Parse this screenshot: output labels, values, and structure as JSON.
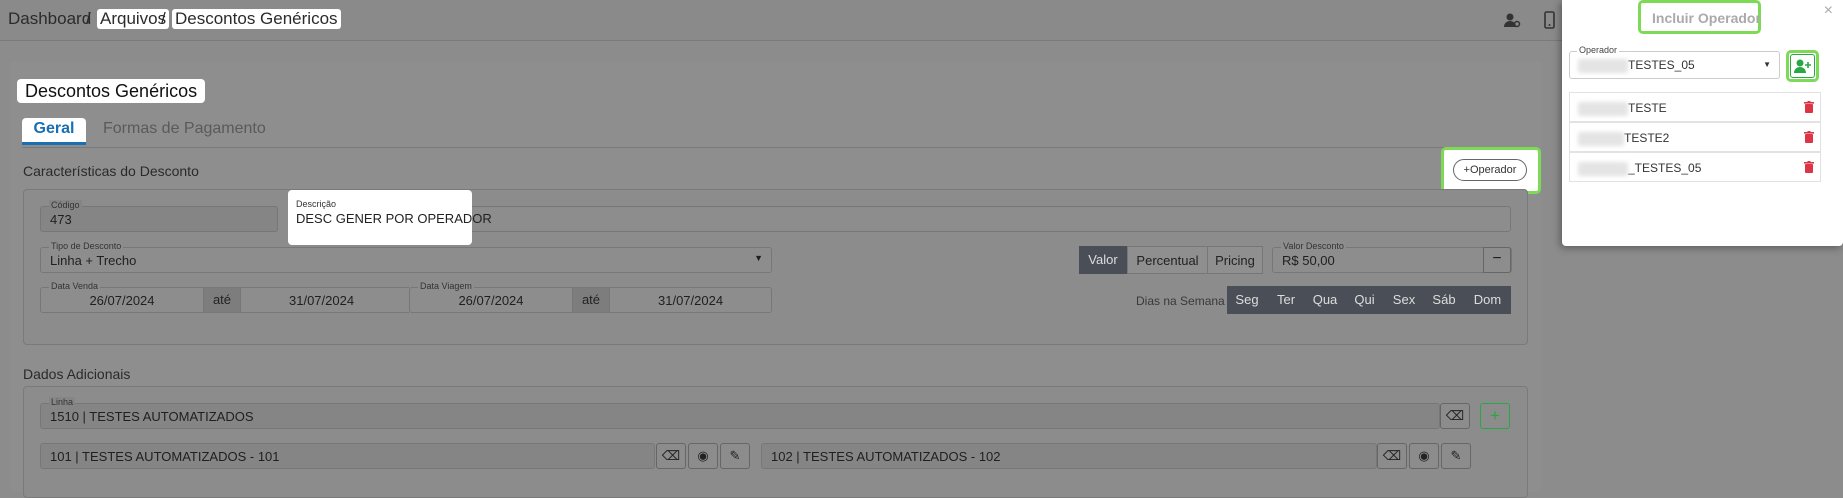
{
  "breadcrumb": {
    "dashboard": "Dashboard",
    "sep1": "/",
    "arquivos": "Arquivos",
    "sep2": "/",
    "current": "Descontos Genéricos"
  },
  "page_title": "Descontos Genéricos",
  "tabs": {
    "geral": "Geral",
    "formas": "Formas de Pagamento"
  },
  "caracteristicas": {
    "title": "Características do Desconto",
    "operador_button": "Operador",
    "codigo": {
      "label": "Código",
      "value": "473"
    },
    "descricao": {
      "label": "Descrição",
      "value": "DESC GENER POR OPERADOR"
    },
    "tipo": {
      "label": "Tipo de Desconto",
      "value": "Linha + Trecho"
    },
    "toggle": [
      "Valor",
      "Percentual",
      "Pricing"
    ],
    "valor_desconto": {
      "label": "Valor Desconto",
      "value": "R$ 50,00"
    },
    "data_venda": {
      "label": "Data Venda",
      "from": "26/07/2024",
      "ate": "até",
      "to": "31/07/2024"
    },
    "data_viagem": {
      "label": "Data Viagem",
      "from": "26/07/2024",
      "ate": "até",
      "to": "31/07/2024"
    },
    "dias_label": "Dias na Semana",
    "dias": [
      "Seg",
      "Ter",
      "Qua",
      "Qui",
      "Sex",
      "Sáb",
      "Dom"
    ]
  },
  "dados_adicionais": {
    "title": "Dados Adicionais",
    "linha": {
      "label": "Linha",
      "value": "1510 | TESTES AUTOMATIZADOS"
    },
    "trecho1": "101 | TESTES AUTOMATIZADOS - 101",
    "trecho2": "102 | TESTES AUTOMATIZADOS - 102"
  },
  "panel": {
    "title": "Incluir Operador",
    "close": "×",
    "operador": {
      "label": "Operador",
      "value_suffix": "TESTES_05"
    },
    "items": [
      {
        "suffix": "TESTE"
      },
      {
        "suffix": "TESTE2"
      },
      {
        "suffix": "_TESTES_05"
      }
    ]
  },
  "colors": {
    "highlight": "#7ed957",
    "primary": "#1a6fb3",
    "danger": "#dc3545",
    "success": "#28a745"
  }
}
